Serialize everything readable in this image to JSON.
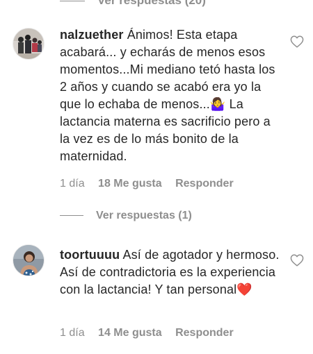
{
  "top_replies": {
    "label": "Ver respuestas (20)"
  },
  "comments": [
    {
      "username": "nalzuether",
      "text": "Ánimos! Esta etapa acabará... y echarás de menos esos momentos...Mi mediano tetó hasta los 2 años y cuando se acabó era yo la que lo echaba de menos...",
      "emoji": "🤷‍♀️",
      "text_after": " La lactancia materna es sacrificio pero a la vez es de lo más bonito de la maternidad.",
      "time": "1 día",
      "likes": "18 Me gusta",
      "reply": "Responder",
      "replies_label": "Ver respuestas (1)",
      "avatar_icon": "family-photo-icon",
      "like_icon": "heart-icon"
    },
    {
      "username": "toortuuuu",
      "text": "Así de agotador y hermoso. Así de contradictoria es la experiencia con la lactancia! Y tan personal",
      "emoji": "❤️",
      "time": "1 día",
      "likes": "14 Me gusta",
      "reply": "Responder",
      "avatar_icon": "person-photo-icon",
      "like_icon": "heart-icon"
    }
  ],
  "colors": {
    "text": "#262626",
    "secondary": "#8e8e8e",
    "heart_emoji": "#e0245e"
  }
}
